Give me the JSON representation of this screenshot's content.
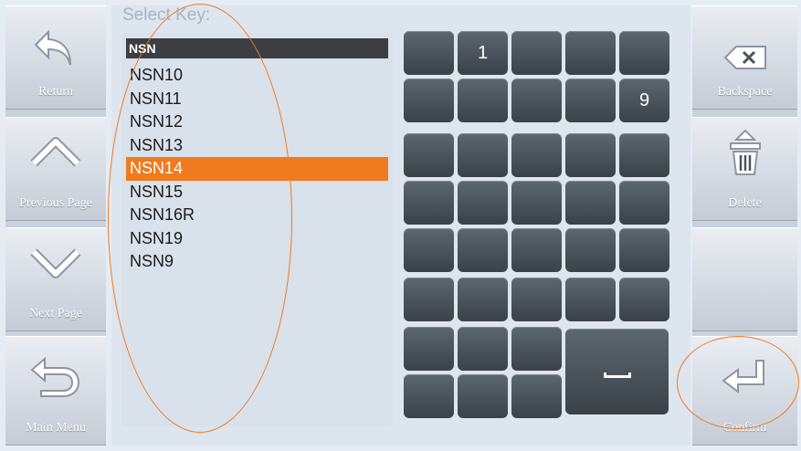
{
  "title": "Select Key:",
  "list": {
    "header": "NSN",
    "items": [
      "NSN10",
      "NSN11",
      "NSN12",
      "NSN13",
      "NSN14",
      "NSN15",
      "NSN16R",
      "NSN19",
      "NSN9"
    ],
    "selected": "NSN14"
  },
  "left_buttons": [
    {
      "label": "Return",
      "icon": "return-arrow-icon"
    },
    {
      "label": "Previous Page",
      "icon": "chevron-up-icon"
    },
    {
      "label": "Next Page",
      "icon": "chevron-down-icon"
    },
    {
      "label": "Main Menu",
      "icon": "u-turn-arrow-icon"
    }
  ],
  "right_buttons": [
    {
      "label": "Backspace",
      "icon": "backspace-icon"
    },
    {
      "label": "Delete",
      "icon": "trash-icon"
    },
    {
      "label": "",
      "icon": ""
    },
    {
      "label": "Confirm",
      "icon": "enter-arrow-icon"
    }
  ],
  "keypad": {
    "row1": [
      "",
      "1",
      "",
      "",
      ""
    ],
    "row2": [
      "",
      "",
      "",
      "",
      "9"
    ],
    "space_label": "space"
  },
  "colors": {
    "accent": "#f07a1e",
    "key": "#4a545c",
    "rail": "#c9d1dc"
  }
}
